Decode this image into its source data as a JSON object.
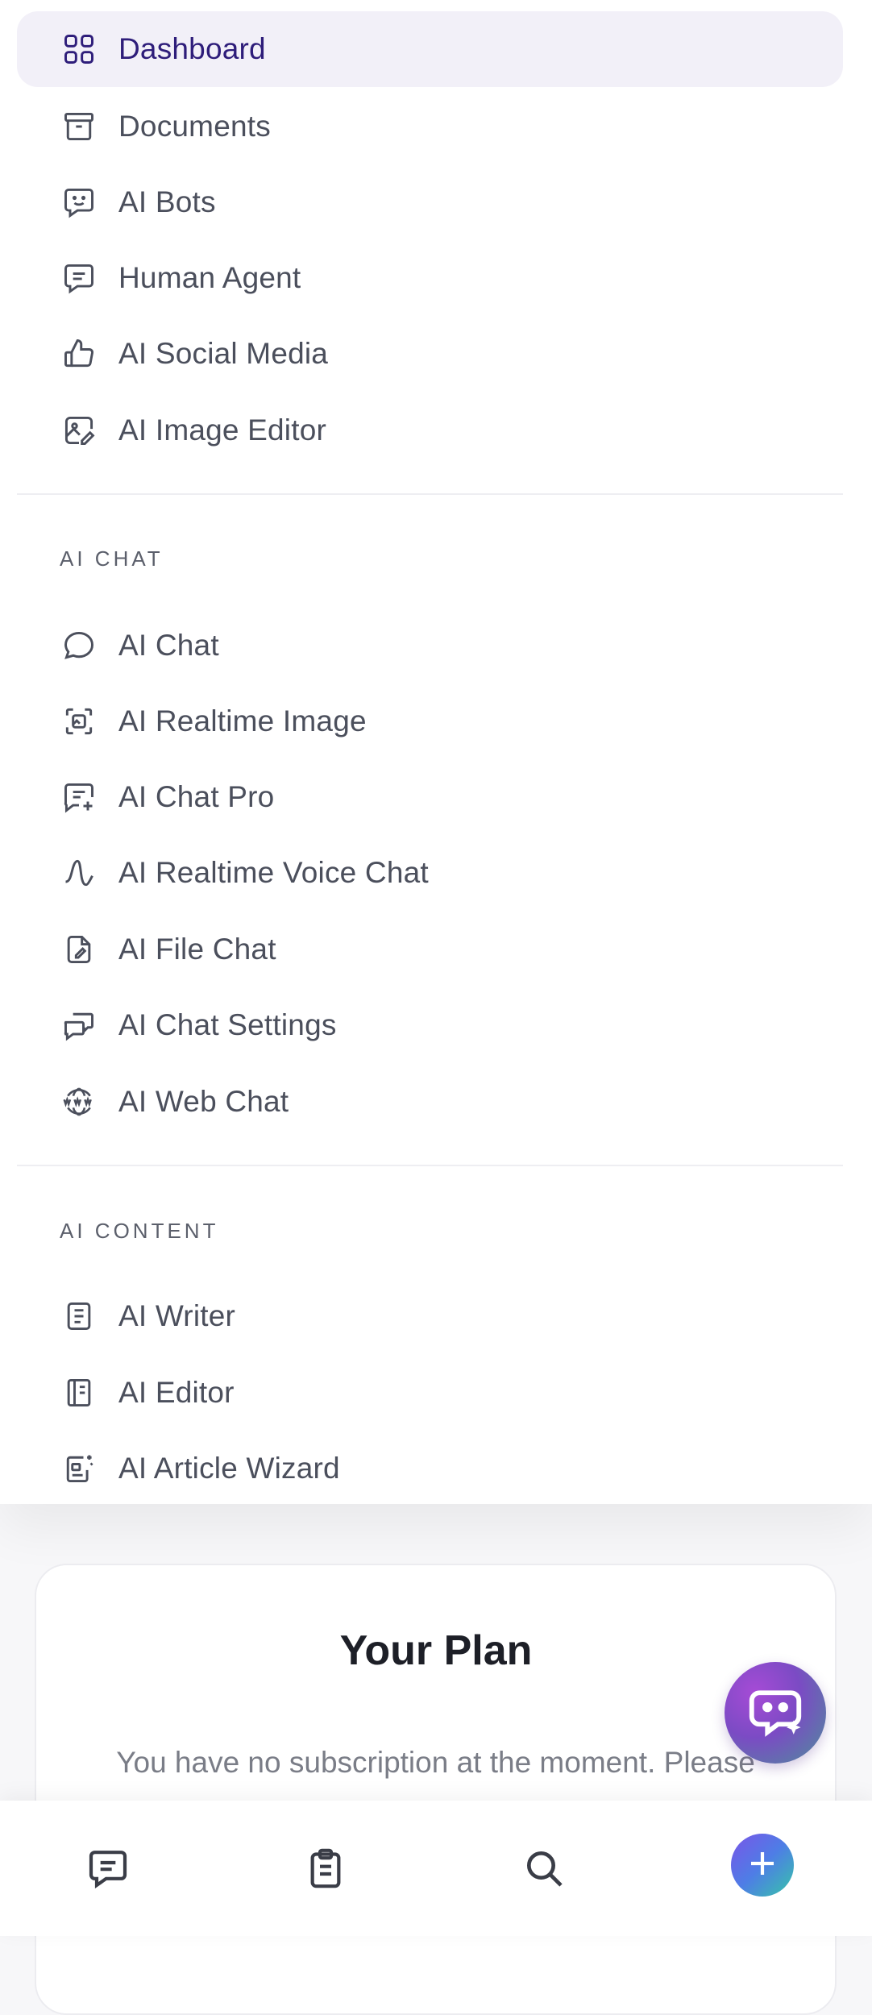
{
  "menu": {
    "main_items": [
      {
        "label": "Dashboard",
        "icon": "grid-icon",
        "active": true
      },
      {
        "label": "Documents",
        "icon": "archive-icon"
      },
      {
        "label": "AI Bots",
        "icon": "bot-chat-icon"
      },
      {
        "label": "Human Agent",
        "icon": "message-square-icon"
      },
      {
        "label": "AI Social Media",
        "icon": "thumbs-up-icon"
      },
      {
        "label": "AI Image Editor",
        "icon": "image-edit-icon"
      }
    ],
    "ai_chat": {
      "title": "AI CHAT",
      "items": [
        {
          "label": "AI Chat",
          "icon": "chat-bubble-icon"
        },
        {
          "label": "AI Realtime Image",
          "icon": "image-frame-icon"
        },
        {
          "label": "AI Chat Pro",
          "icon": "message-plus-icon"
        },
        {
          "label": "AI Realtime Voice Chat",
          "icon": "waveform-icon"
        },
        {
          "label": "AI File Chat",
          "icon": "file-edit-icon"
        },
        {
          "label": "AI Chat Settings",
          "icon": "messages-icon"
        },
        {
          "label": "AI Web Chat",
          "icon": "www-icon"
        }
      ]
    },
    "ai_content": {
      "title": "AI CONTENT",
      "items": [
        {
          "label": "AI Writer",
          "icon": "document-text-icon"
        },
        {
          "label": "AI Editor",
          "icon": "notebook-icon"
        },
        {
          "label": "AI Article Wizard",
          "icon": "article-wizard-icon"
        }
      ]
    }
  },
  "plan": {
    "title": "Your Plan",
    "description": "You have no subscription at the moment. Please"
  },
  "bottom_nav": {
    "items": [
      {
        "icon": "message-icon"
      },
      {
        "icon": "clipboard-icon"
      },
      {
        "icon": "search-icon"
      },
      {
        "icon": "plus-icon"
      }
    ]
  },
  "colors": {
    "active_bg": "#f2f0f8",
    "active_text": "#2e1d7a",
    "text": "#4b4f5c",
    "fab_gradient_start": "#a64bd6",
    "fab_gradient_end": "#4d8f9a"
  }
}
